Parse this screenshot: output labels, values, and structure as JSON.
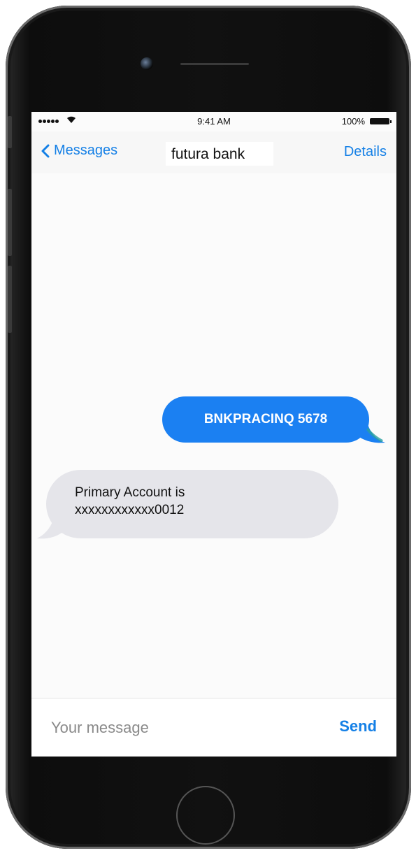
{
  "status_bar": {
    "time": "9:41 AM",
    "battery": "100%",
    "signal_icon": "signal-dots-icon",
    "wifi_icon": "wifi-icon"
  },
  "nav": {
    "back_label": "Messages",
    "title": "futura bank",
    "details_label": "Details",
    "accent_color": "#1580e6"
  },
  "messages": [
    {
      "direction": "outgoing",
      "text": "BNKPRACINQ 5678",
      "color": "#1b80f2"
    },
    {
      "direction": "incoming",
      "lines": [
        "Primary Account is",
        "xxxxxxxxxxxx0012"
      ],
      "color": "#e5e5ea"
    }
  ],
  "composer": {
    "placeholder": "Your message",
    "send_label": "Send"
  }
}
